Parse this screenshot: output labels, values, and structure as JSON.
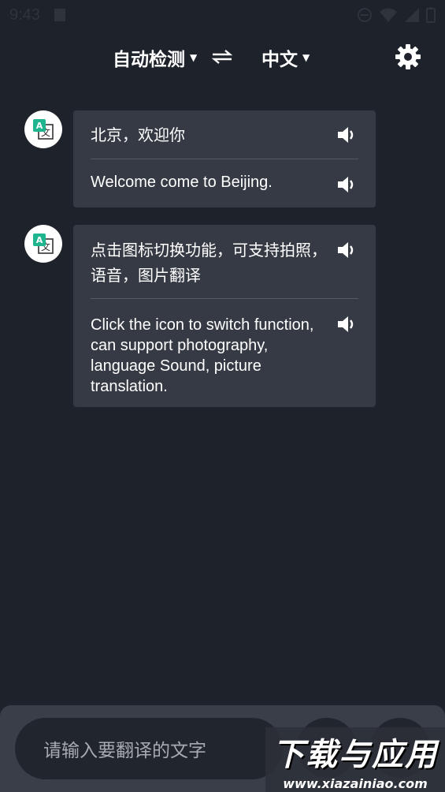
{
  "status_bar": {
    "time": "9:43"
  },
  "header": {
    "source_lang": "自动检测",
    "target_lang": "中文"
  },
  "messages": [
    {
      "source": "北京，欢迎你",
      "translation": "Welcome come to Beijing."
    },
    {
      "source": "点击图标切换功能，可支持拍照，语音，图片翻译",
      "translation": "Click the icon to switch function, can support photography, language Sound, picture translation."
    }
  ],
  "input": {
    "placeholder": "请输入要翻译的文字"
  },
  "watermark": {
    "text": "下载与应用",
    "url": "www.xiazainiao.com"
  },
  "colors": {
    "background": "#1e222b",
    "bubble": "#363a44",
    "accent": "#1fb58f"
  }
}
